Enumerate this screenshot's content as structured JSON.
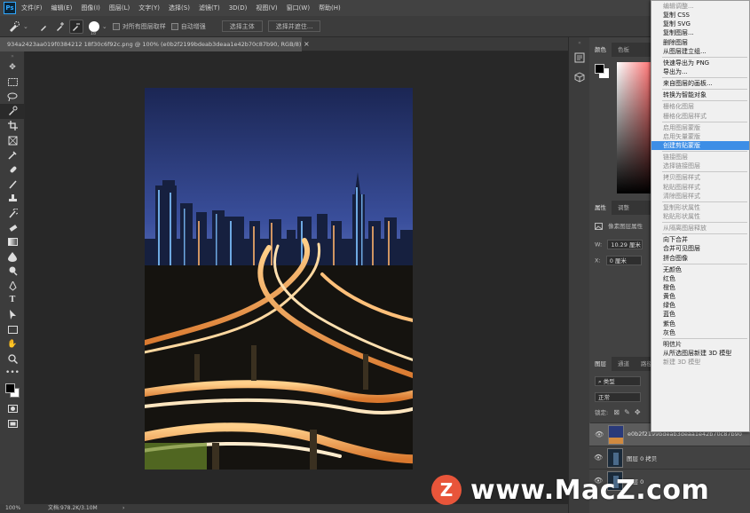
{
  "menubar": {
    "logo": "Ps",
    "items": [
      "文件(F)",
      "编辑(E)",
      "图像(I)",
      "图层(L)",
      "文字(Y)",
      "选择(S)",
      "滤镜(T)",
      "3D(D)",
      "视图(V)",
      "窗口(W)",
      "帮助(H)"
    ]
  },
  "options": {
    "brush_size": "18",
    "sample_all_layers": "对所有图层取样",
    "auto_enhance": "自动增强",
    "select_subject": "选择主体",
    "select_and_mask": "选择并遮住..."
  },
  "document": {
    "tab_title": "934a2423aa019f0384212 18f30c6f92c.png @ 100% (e0b2f2199bdeab3deaa1e42b70c87b90, RGB/8) *",
    "close_glyph": "×"
  },
  "status": {
    "zoom": "100%",
    "doc_size": "文档:978.2K/3.10M",
    "arrow": "›"
  },
  "panels": {
    "color_tabs": [
      "颜色",
      "色板"
    ],
    "properties_tabs": [
      "属性",
      "调整"
    ],
    "pixel_layer": "像素图层属性",
    "width_label": "W:",
    "width_value": "10.29 厘米",
    "x_label": "X:",
    "x_value": "0 厘米",
    "layers_tabs": [
      "图层",
      "通道",
      "路径"
    ],
    "kind_filter": "类型",
    "blend_mode": "正常",
    "lock_label": "锁定:",
    "layers": [
      {
        "name": "e0b2f2199bdeab3deaa1e42b70c87b90",
        "selected": true
      },
      {
        "name": "图层 0 拷贝",
        "selected": false
      },
      {
        "name": "图层 0",
        "selected": false
      }
    ]
  },
  "context_menu": {
    "items": [
      {
        "label": "编辑调整...",
        "disabled": true
      },
      {
        "label": "复制 CSS",
        "disabled": false
      },
      {
        "label": "复制 SVG",
        "disabled": false
      },
      {
        "label": "复制图层...",
        "disabled": false
      },
      {
        "label": "删除图层",
        "disabled": false
      },
      {
        "label": "从图层建立组...",
        "disabled": false
      },
      {
        "sep": true
      },
      {
        "label": "快速导出为 PNG",
        "disabled": false
      },
      {
        "label": "导出为...",
        "disabled": false
      },
      {
        "sep": true
      },
      {
        "label": "来自图层的画板...",
        "disabled": false
      },
      {
        "sep": true
      },
      {
        "label": "转换为智能对象",
        "disabled": false
      },
      {
        "sep": true
      },
      {
        "label": "栅格化图层",
        "disabled": true
      },
      {
        "label": "栅格化图层样式",
        "disabled": true
      },
      {
        "sep": true
      },
      {
        "label": "启用图层蒙版",
        "disabled": true
      },
      {
        "label": "启用矢量蒙版",
        "disabled": true
      },
      {
        "label": "创建剪贴蒙版",
        "disabled": false,
        "highlight": true
      },
      {
        "sep": true
      },
      {
        "label": "链接图层",
        "disabled": true
      },
      {
        "label": "选择链接图层",
        "disabled": true
      },
      {
        "sep": true
      },
      {
        "label": "拷贝图层样式",
        "disabled": true
      },
      {
        "label": "粘贴图层样式",
        "disabled": true
      },
      {
        "label": "清除图层样式",
        "disabled": true
      },
      {
        "sep": true
      },
      {
        "label": "复制形状属性",
        "disabled": true
      },
      {
        "label": "粘贴形状属性",
        "disabled": true
      },
      {
        "sep": true
      },
      {
        "label": "从隔离图层释放",
        "disabled": true
      },
      {
        "sep": true
      },
      {
        "label": "向下合并",
        "disabled": false
      },
      {
        "label": "合并可见图层",
        "disabled": false
      },
      {
        "label": "拼合图像",
        "disabled": false
      },
      {
        "sep": true
      },
      {
        "label": "无颜色",
        "disabled": false
      },
      {
        "label": "红色",
        "disabled": false
      },
      {
        "label": "橙色",
        "disabled": false
      },
      {
        "label": "黄色",
        "disabled": false
      },
      {
        "label": "绿色",
        "disabled": false
      },
      {
        "label": "蓝色",
        "disabled": false
      },
      {
        "label": "紫色",
        "disabled": false
      },
      {
        "label": "灰色",
        "disabled": false
      },
      {
        "sep": true
      },
      {
        "label": "明信片",
        "disabled": false
      },
      {
        "label": "从所选图层新建 3D 模型",
        "disabled": false
      },
      {
        "label": "新建 3D 模型",
        "disabled": true
      }
    ]
  },
  "watermark": {
    "logo": "Z",
    "text": "www.MacZ.com"
  },
  "colors": {
    "menu_highlight": "#3d8ee6",
    "accent": "#31a8ff"
  }
}
